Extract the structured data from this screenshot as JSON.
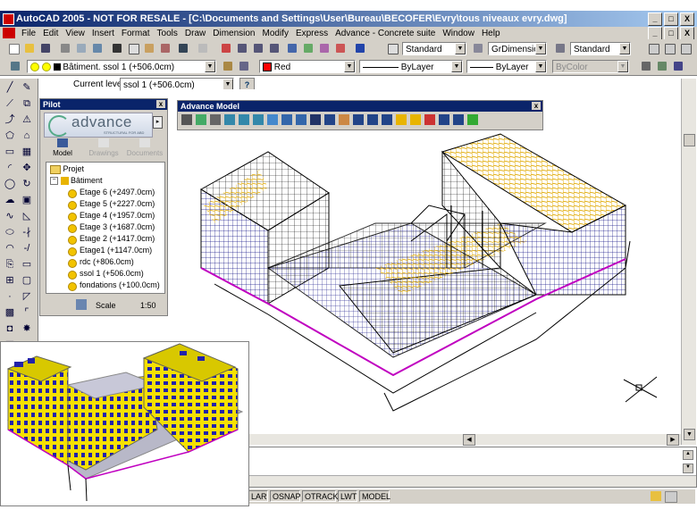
{
  "window": {
    "title": "AutoCAD 2005 - NOT FOR RESALE - [C:\\Documents and Settings\\User\\Bureau\\BECOFER\\Evry\\tous niveaux evry.dwg]",
    "buttons": [
      "_",
      "□",
      "X"
    ]
  },
  "menu": [
    "File",
    "Edit",
    "View",
    "Insert",
    "Format",
    "Tools",
    "Draw",
    "Dimension",
    "Modify",
    "Express",
    "Advance - Concrete suite",
    "Window",
    "Help"
  ],
  "toolbar_styles": {
    "text_style": "Standard",
    "dim_style": "GrDimensions",
    "table_style": "Standard"
  },
  "layer_toolbar": {
    "layer": "Bâtiment. ssol 1 (+506.0cm)",
    "color": "Red",
    "linetype": "ByLayer",
    "lineweight": "ByLayer",
    "plotstyle": "ByColor",
    "red_hex": "#ff0000"
  },
  "current_level": {
    "label": "Current level :",
    "value": "ssol 1 (+506.0cm)",
    "help": "?"
  },
  "pilot": {
    "title": "Pilot",
    "logo_text": "advance",
    "logo_sub": "STRUCTURAL FOR ABD",
    "tabs": [
      "Model",
      "Drawings",
      "Documents"
    ],
    "tree": {
      "root": "Projet",
      "building": "Bâtiment",
      "levels": [
        "Etage 6 (+2497.0cm)",
        "Etage 5 (+2227.0cm)",
        "Etage 4 (+1957.0cm)",
        "Etage 3 (+1687.0cm)",
        "Etage 2 (+1417.0cm)",
        "Etage1 (+1147.0cm)",
        "rdc (+806.0cm)",
        "ssol 1 (+506.0cm)",
        "fondations (+100.0cm)"
      ]
    },
    "scale_label": "Scale",
    "scale_value": "1:50"
  },
  "advance_model": {
    "title": "Advance Model"
  },
  "status": {
    "buttons": [
      "LAR",
      "OSNAP",
      "OTRACK",
      "LWT",
      "MODEL"
    ]
  },
  "colors": {
    "title_blue": "#0a246a",
    "wire_yellow": "#e8b400",
    "wire_magenta": "#c000c0",
    "wire_blue": "#0000a0",
    "render_yellow": "#f5e000",
    "render_blue": "#2222aa"
  }
}
